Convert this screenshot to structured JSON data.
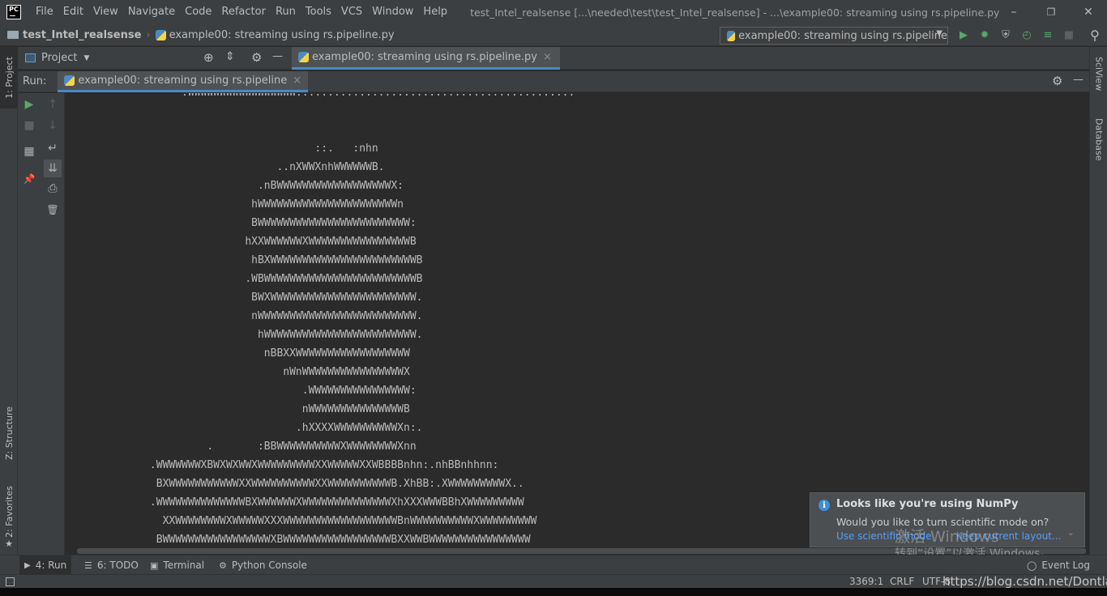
{
  "menubar": {
    "logo": "PC",
    "items": [
      "File",
      "Edit",
      "View",
      "Navigate",
      "Code",
      "Refactor",
      "Run",
      "Tools",
      "VCS",
      "Window",
      "Help"
    ],
    "window_title": "test_Intel_realsense [...\\needed\\test\\test_Intel_realsense] - ...\\example00:  streaming using rs.pipeline.py",
    "minimize": "–",
    "restore": "❐",
    "close": "✕"
  },
  "navbar": {
    "project": "test_Intel_realsense",
    "separator": "›",
    "file": "example00:  streaming using rs.pipeline.py",
    "run_config": "example00:  streaming using rs.pipeline",
    "dropdown_chevron": "▼"
  },
  "toolbar_icons": {
    "run": "▶",
    "debug": "✹",
    "coverage": "⛨",
    "profile": "◴",
    "concurrency": "≡",
    "stop": "■",
    "search": "⚲"
  },
  "left_strip": {
    "project_tab": "1: Project",
    "structure_tab": "Z: Structure",
    "favorites_tab": "2: Favorites",
    "favorites_star": "★"
  },
  "right_strip": {
    "sciview_tab": "SciView",
    "database_tab": "Database"
  },
  "project_panel": {
    "label": "Project",
    "chevron": "▼",
    "locate_icon": "⊕",
    "collapse_icon": "⇕",
    "settings_icon": "⚙",
    "hide_icon": "—"
  },
  "editor": {
    "tab_label": "example00:  streaming using rs.pipeline.py",
    "tab_close": "×"
  },
  "run_window": {
    "label": "Run:",
    "tab_label": "example00:  streaming using rs.pipeline",
    "tab_close": "×",
    "settings_icon": "⚙",
    "hide_icon": "—",
    "tools": {
      "rerun": "▶",
      "stop": "■",
      "layout": "▦",
      "pin": "📌",
      "up": "↑",
      "down": "↓",
      "soft_wrap": "↵",
      "scroll_end": "⇊",
      "print": "⎙",
      "clear": "🗑"
    }
  },
  "console": {
    "lines": [
      "                 .WWWWWWWWWWWWWWWWW:...........................................",
      "",
      "",
      "                                      ::.   :nhn",
      "                                ..nXWWXnhWWWWWWB.",
      "                             .nBWWWWWWWWWWWWWWWWWWX:",
      "                            hWWWWWWWWWWWWWWWWWWWWWWn",
      "                            BWWWWWWWWWWWWWWWWWWWWWWWW:",
      "                           hXXWWWWWWXWWWWWWWWWWWWWWWWB",
      "                            hBXWWWWWWWWWWWWWWWWWWWWWWWB",
      "                           .WBWWWWWWWWWWWWWWWWWWWWWWWWB",
      "                            BWXWWWWWWWWWWWWWWWWWWWWWWW.",
      "                            nWWWWWWWWWWWWWWWWWWWWWWWWW.",
      "                             hWWWWWWWWWWWWWWWWWWWWWWWW.",
      "                              nBBXXWWWWWWWWWWWWWWWWWW",
      "                                 nWnWWWWWWWWWWWWWWWWX",
      "                                    .WWWWWWWWWWWWWWWW:",
      "                                    nWWWWWWWWWWWWWWWB",
      "                                   .hXXXXWWWWWWWWWWXn:.",
      "                     .       :BBWWWWWWWWWWXWWWWWWWWXnn",
      "            .WWWWWWWXBWXWXWWXWWWWWWWWWXXWWWWWXXWBBBBnhn:.nhBBnhhnn:",
      "             BXWWWWWWWWWWWXXWWWWWWWWWWXXWWWWWWWWWWB.XhBB:.XWWWWWWWWWX..",
      "            .WWWWWWWWWWWWWWBXWWWWWWXWWWWWWWWWWWWWWXhXXXWWWBBhXWWWWWWWWW",
      "              XXWWWWWWWWXWWWWWXXXWWWWWWWWWWWWWWWWWWBnWWWWWWWWWWXWWWWWWWWW",
      "             BWWWWWWWWWWWWWWWWWXBWWWWWWWWWWWWWWWWWBXXWWBWWWWWWWWWWWWWWWW"
    ]
  },
  "notification": {
    "title": "Looks like you're using NumPy",
    "text": "Would you like to turn scientific mode on?",
    "link1": "Use scientific mode",
    "link2": "Keep current layout...",
    "info_icon": "i",
    "collapse": "⌄"
  },
  "watermark": {
    "line1": "激活 Windows",
    "line2": "转到“设置”以激活 Windows。"
  },
  "bottom_bar": {
    "run": "4: Run",
    "todo": "6: TODO",
    "terminal": "Terminal",
    "python_console": "Python Console",
    "event_log": "Event Log",
    "run_icon": "▶",
    "todo_icon": "☰",
    "terminal_icon": "▣",
    "console_icon": "⚙",
    "event_icon": "◯"
  },
  "status_bar": {
    "position": "3369:1",
    "line_sep": "CRLF",
    "encoding": "UTF-8",
    "url": "https://blog.csdn.net/Dontla"
  }
}
